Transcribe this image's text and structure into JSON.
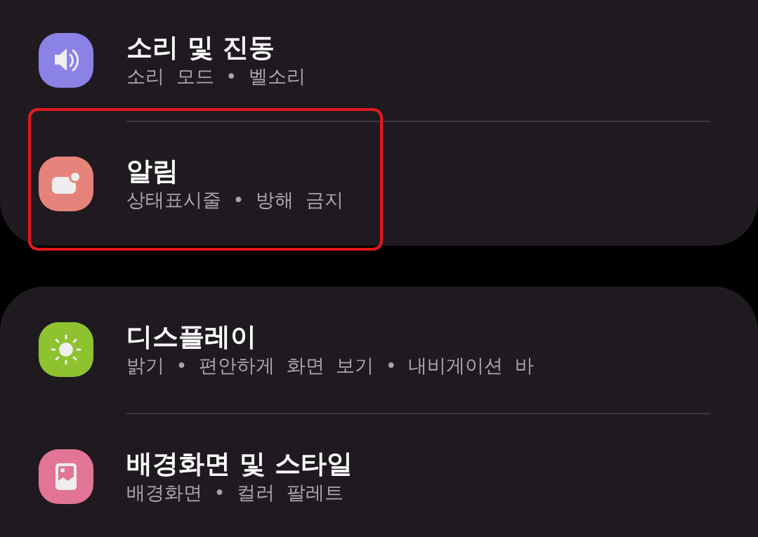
{
  "sections": [
    {
      "items": [
        {
          "kind": "sound",
          "color": "#8b82e6",
          "title": "소리 및 진동",
          "subtitle": "소리 모드 • 벨소리",
          "highlighted": false
        },
        {
          "kind": "notification",
          "color": "#e5837a",
          "title": "알림",
          "subtitle": "상태표시줄 • 방해 금지",
          "highlighted": true
        }
      ]
    },
    {
      "items": [
        {
          "kind": "display",
          "color": "#8fc22f",
          "title": "디스플레이",
          "subtitle": "밝기 • 편안하게 화면 보기 • 내비게이션 바",
          "highlighted": false
        },
        {
          "kind": "wallpaper",
          "color": "#e27596",
          "title": "배경화면 및 스타일",
          "subtitle": "배경화면 • 컬러 팔레트",
          "highlighted": false
        }
      ]
    }
  ]
}
